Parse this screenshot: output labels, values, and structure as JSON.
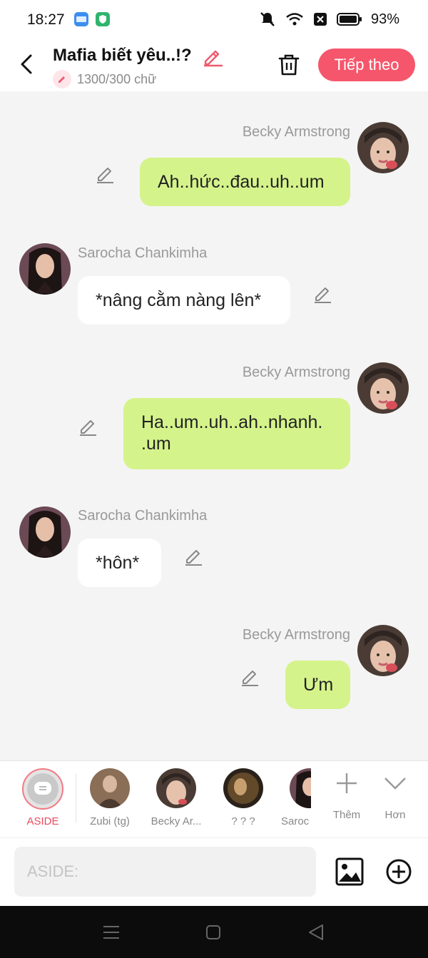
{
  "status": {
    "time": "18:27",
    "battery": "93%"
  },
  "header": {
    "title": "Mafia biết yêu..!?",
    "word_count": "1300/300 chữ",
    "next_label": "Tiếp theo"
  },
  "messages": [
    {
      "side": "right",
      "sender": "Becky Armstrong",
      "text": "Ah..hức..đau..uh..um"
    },
    {
      "side": "left",
      "sender": "Sarocha Chankimha",
      "text": "*nâng cằm nàng lên*"
    },
    {
      "side": "right",
      "sender": "Becky Armstrong",
      "line1": "Ha..um..uh..ah..nhanh.",
      "line2": ".um"
    },
    {
      "side": "left",
      "sender": "Sarocha Chankimha",
      "text": "*hôn*"
    },
    {
      "side": "right",
      "sender": "Becky Armstrong",
      "text": "Ưm"
    }
  ],
  "characters": [
    {
      "label": "ASIDE"
    },
    {
      "label": "Zubi (tg)"
    },
    {
      "label": "Becky Ar..."
    },
    {
      "label": "? ? ?"
    },
    {
      "label": "Saroc"
    }
  ],
  "actions": {
    "more_label": "Thêm",
    "less_label": "Hơn"
  },
  "input": {
    "placeholder": "ASIDE:"
  },
  "colors": {
    "accent": "#f6566c",
    "bubble_right": "#d5f38b",
    "bubble_left": "#ffffff",
    "aside_label": "#e94b5e"
  }
}
